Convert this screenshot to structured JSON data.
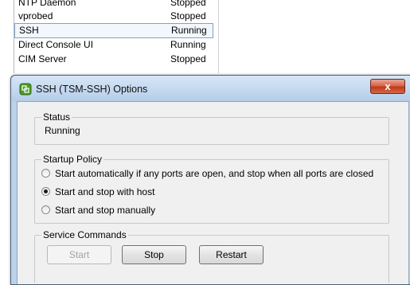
{
  "services": [
    {
      "name": "NTP Daemon",
      "status": "Stopped"
    },
    {
      "name": "vprobed",
      "status": "Stopped"
    },
    {
      "name": "SSH",
      "status": "Running"
    },
    {
      "name": "Direct Console UI",
      "status": "Running"
    },
    {
      "name": "CIM Server",
      "status": "Stopped"
    }
  ],
  "dialog": {
    "title": "SSH (TSM-SSH) Options",
    "close_label": "x",
    "status": {
      "label": "Status",
      "value": "Running"
    },
    "startup_policy": {
      "label": "Startup Policy",
      "options": [
        {
          "label": "Start automatically if any ports are open, and stop when all ports are closed",
          "selected": false
        },
        {
          "label": "Start and stop with host",
          "selected": true
        },
        {
          "label": "Start and stop manually",
          "selected": false
        }
      ]
    },
    "service_commands": {
      "label": "Service Commands",
      "start_label": "Start",
      "stop_label": "Stop",
      "restart_label": "Restart"
    }
  }
}
